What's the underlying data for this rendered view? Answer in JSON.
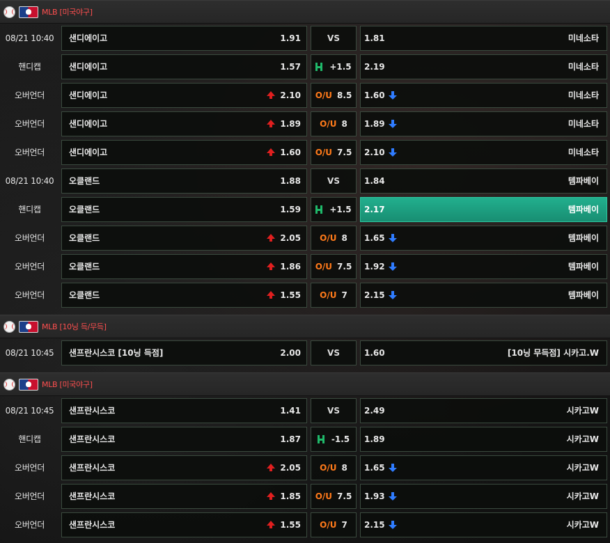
{
  "sections": [
    {
      "league": "MLB [미국야구]",
      "rows": [
        {
          "time": "08/21 10:40",
          "home": "샌디에이고",
          "home_odds": "1.91",
          "type": "vs",
          "mid": "VS",
          "away_odds": "1.81",
          "away": "미네소타"
        },
        {
          "time": "핸디캡",
          "home": "샌디에이고",
          "home_odds": "1.57",
          "type": "handicap",
          "mid": "+1.5",
          "away_odds": "2.19",
          "away": "미네소타"
        },
        {
          "time": "오버언더",
          "home": "샌디에이고",
          "home_odds": "2.10",
          "type": "ou",
          "mid": "8.5",
          "away_odds": "1.60",
          "away": "미네소타"
        },
        {
          "time": "오버언더",
          "home": "샌디에이고",
          "home_odds": "1.89",
          "type": "ou",
          "mid": "8",
          "away_odds": "1.89",
          "away": "미네소타"
        },
        {
          "time": "오버언더",
          "home": "샌디에이고",
          "home_odds": "1.60",
          "type": "ou",
          "mid": "7.5",
          "away_odds": "2.10",
          "away": "미네소타"
        },
        {
          "time": "08/21 10:40",
          "home": "오클랜드",
          "home_odds": "1.88",
          "type": "vs",
          "mid": "VS",
          "away_odds": "1.84",
          "away": "템파베이"
        },
        {
          "time": "핸디캡",
          "home": "오클랜드",
          "home_odds": "1.59",
          "type": "handicap",
          "mid": "+1.5",
          "away_odds": "2.17",
          "away": "템파베이",
          "selected": true
        },
        {
          "time": "오버언더",
          "home": "오클랜드",
          "home_odds": "2.05",
          "type": "ou",
          "mid": "8",
          "away_odds": "1.65",
          "away": "템파베이"
        },
        {
          "time": "오버언더",
          "home": "오클랜드",
          "home_odds": "1.86",
          "type": "ou",
          "mid": "7.5",
          "away_odds": "1.92",
          "away": "템파베이"
        },
        {
          "time": "오버언더",
          "home": "오클랜드",
          "home_odds": "1.55",
          "type": "ou",
          "mid": "7",
          "away_odds": "2.15",
          "away": "템파베이"
        }
      ]
    },
    {
      "league": "MLB [10닝 득/무득]",
      "rows": [
        {
          "time": "08/21 10:45",
          "home": "샌프란시스코 [10닝 득점]",
          "home_odds": "2.00",
          "type": "vs",
          "mid": "VS",
          "away_odds": "1.60",
          "away": "[10닝 무득점] 시카고.W"
        }
      ]
    },
    {
      "league": "MLB [미국야구]",
      "rows": [
        {
          "time": "08/21 10:45",
          "home": "샌프란시스코",
          "home_odds": "1.41",
          "type": "vs",
          "mid": "VS",
          "away_odds": "2.49",
          "away": "시카고W"
        },
        {
          "time": "핸디캡",
          "home": "샌프란시스코",
          "home_odds": "1.87",
          "type": "handicap",
          "mid": "-1.5",
          "away_odds": "1.89",
          "away": "시카고W"
        },
        {
          "time": "오버언더",
          "home": "샌프란시스코",
          "home_odds": "2.05",
          "type": "ou",
          "mid": "8",
          "away_odds": "1.65",
          "away": "시카고W"
        },
        {
          "time": "오버언더",
          "home": "샌프란시스코",
          "home_odds": "1.85",
          "type": "ou",
          "mid": "7.5",
          "away_odds": "1.93",
          "away": "시카고W"
        },
        {
          "time": "오버언더",
          "home": "샌프란시스코",
          "home_odds": "1.55",
          "type": "ou",
          "mid": "7",
          "away_odds": "2.15",
          "away": "시카고W"
        }
      ]
    }
  ],
  "labels": {
    "ou": "O/U"
  },
  "icons": {
    "sport": "baseball-icon",
    "league": "mlb-logo",
    "up": "arrow-up-icon",
    "down": "arrow-down-icon",
    "handicap": "handicap-icon"
  },
  "colors": {
    "league_text": "#ff4f4f",
    "ou_text": "#ff7a1a",
    "handicap_icon": "#1fb96a",
    "up_arrow": "#e01f1f",
    "down_arrow": "#2f7cff",
    "selected_bg": "#1fa383"
  }
}
